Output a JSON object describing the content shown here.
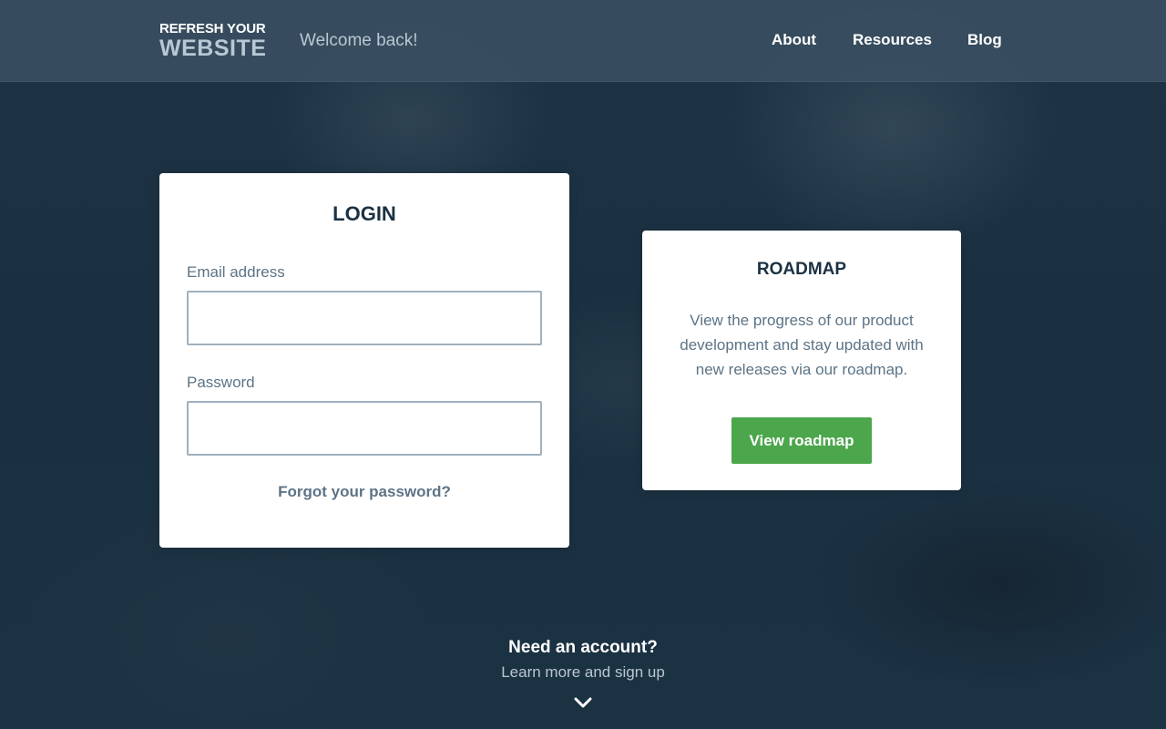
{
  "header": {
    "logo_top": "REFRESH YOUR",
    "logo_bottom": "WEBSITE",
    "welcome": "Welcome back!",
    "nav": [
      "About",
      "Resources",
      "Blog"
    ]
  },
  "login": {
    "title": "LOGIN",
    "email_label": "Email address",
    "email_value": "",
    "password_label": "Password",
    "password_value": "",
    "forgot_link": "Forgot your password?"
  },
  "roadmap": {
    "title": "ROADMAP",
    "description": "View the progress of our product development and stay updated with new releases via our roadmap.",
    "button_label": "View roadmap"
  },
  "signup": {
    "title": "Need an account?",
    "subtitle": "Learn more and sign up",
    "chevron_icon": "chevron-down-icon"
  },
  "colors": {
    "background": "#1c3142",
    "header": "#3a5062",
    "accent_green": "#4ca64c",
    "heading": "#1b3142",
    "muted_text": "#5c7486"
  }
}
